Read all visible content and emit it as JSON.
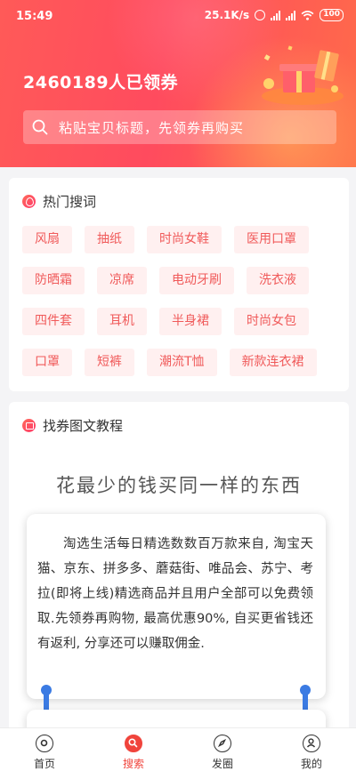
{
  "status_bar": {
    "time": "15:49",
    "network_speed": "25.1K/s",
    "battery": "100"
  },
  "header": {
    "count_text": "2460189人已领券",
    "search_placeholder": "粘贴宝贝标题，先领券再购买"
  },
  "hot_search": {
    "title": "热门搜词",
    "rows": [
      [
        "风扇",
        "抽纸",
        "时尚女鞋",
        "医用口罩"
      ],
      [
        "防晒霜",
        "凉席",
        "电动牙刷",
        "洗衣液"
      ],
      [
        "四件套",
        "耳机",
        "半身裙",
        "时尚女包"
      ],
      [
        "口罩",
        "短裤",
        "潮流T恤",
        "新款连衣裙"
      ]
    ]
  },
  "guide": {
    "title": "找券图文教程",
    "heading": "花最少的钱买同一样的东西",
    "body": "淘选生活每日精选数数百万款来自, 淘宝天猫、京东、拼多多、蘑菇街、唯品会、苏宁、考拉(即将上线)精选商品并且用户全部可以免费领取.先领券再购物, 最高优惠90%, 自买更省钱还有返利, 分享还可以赚取佣金."
  },
  "bottom_nav": [
    {
      "label": "首页",
      "icon": "home-icon"
    },
    {
      "label": "搜索",
      "icon": "search-icon"
    },
    {
      "label": "发圈",
      "icon": "compass-icon"
    },
    {
      "label": "我的",
      "icon": "user-icon"
    }
  ],
  "colors": {
    "brand": "#ff4b5e",
    "active_nav": "#f0443c",
    "tag_bg": "#fff0f0",
    "tag_text": "#f05a5a",
    "pin": "#3b7be3"
  }
}
